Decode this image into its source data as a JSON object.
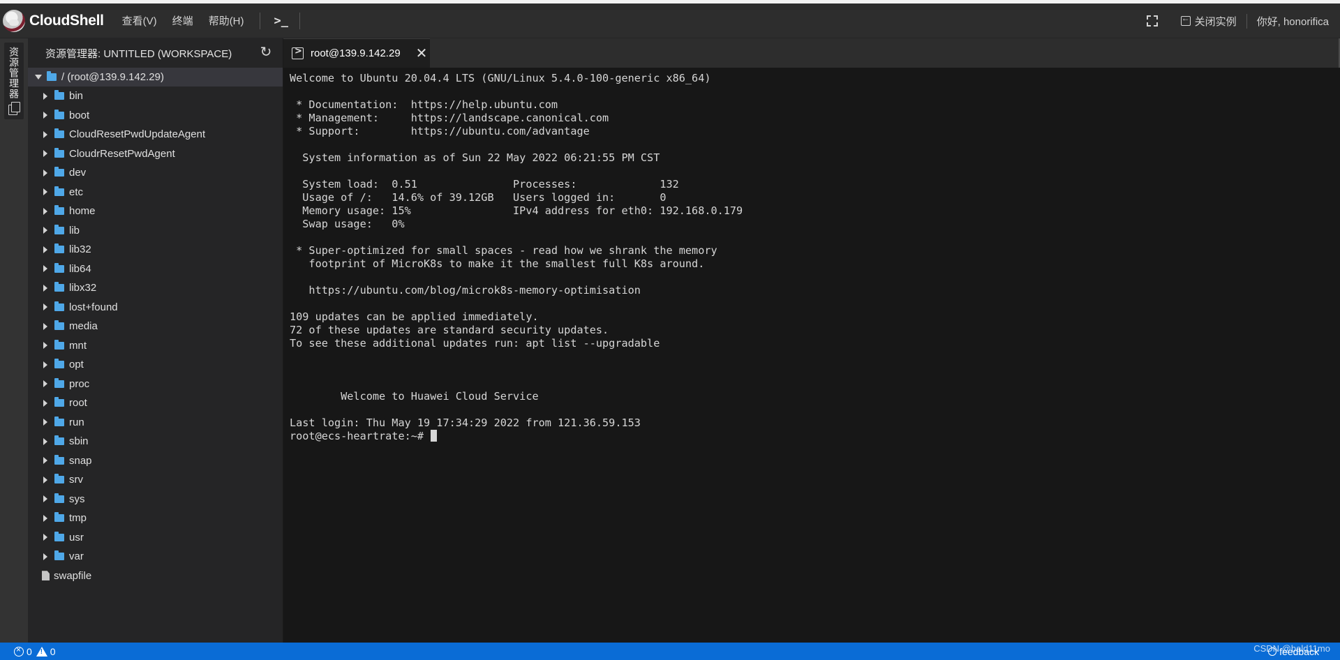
{
  "app": {
    "logo_text": "CloudShell",
    "menu": [
      "查看(V)",
      "终端",
      "帮助(H)"
    ],
    "terminal_button": ">_",
    "close_instance": "关闭实例",
    "greeting": "你好, honorifica"
  },
  "activity_bar": {
    "explorer_label": "资源管理器",
    "icons": [
      "copy-icon"
    ]
  },
  "sidebar": {
    "title": "资源管理器: UNTITLED (WORKSPACE)",
    "root": "/ (root@139.9.142.29)",
    "folders": [
      "bin",
      "boot",
      "CloudResetPwdUpdateAgent",
      "CloudrResetPwdAgent",
      "dev",
      "etc",
      "home",
      "lib",
      "lib32",
      "lib64",
      "libx32",
      "lost+found",
      "media",
      "mnt",
      "opt",
      "proc",
      "root",
      "run",
      "sbin",
      "snap",
      "srv",
      "sys",
      "tmp",
      "usr",
      "var"
    ],
    "files": [
      "swapfile"
    ]
  },
  "tab": {
    "label": "root@139.9.142.29",
    "close": "✕"
  },
  "terminal": {
    "lines": [
      "Welcome to Ubuntu 20.04.4 LTS (GNU/Linux 5.4.0-100-generic x86_64)",
      "",
      " * Documentation:  https://help.ubuntu.com",
      " * Management:     https://landscape.canonical.com",
      " * Support:        https://ubuntu.com/advantage",
      "",
      "  System information as of Sun 22 May 2022 06:21:55 PM CST",
      "",
      "  System load:  0.51               Processes:             132",
      "  Usage of /:   14.6% of 39.12GB   Users logged in:       0",
      "  Memory usage: 15%                IPv4 address for eth0: 192.168.0.179",
      "  Swap usage:   0%",
      "",
      " * Super-optimized for small spaces - read how we shrank the memory",
      "   footprint of MicroK8s to make it the smallest full K8s around.",
      "",
      "   https://ubuntu.com/blog/microk8s-memory-optimisation",
      "",
      "109 updates can be applied immediately.",
      "72 of these updates are standard security updates.",
      "To see these additional updates run: apt list --upgradable",
      "",
      "",
      "",
      "        Welcome to Huawei Cloud Service",
      "",
      "Last login: Thu May 19 17:34:29 2022 from 121.36.59.153"
    ],
    "prompt": "root@ecs-heartrate:~# "
  },
  "statusbar": {
    "errors": "0",
    "warnings": "0",
    "feedback": "feedback",
    "watermark": "CSDN @bald11mo"
  },
  "colors": {
    "status_bar": "#0a6cd6",
    "folder": "#4fa8e8",
    "terminal_bg": "#171717"
  }
}
